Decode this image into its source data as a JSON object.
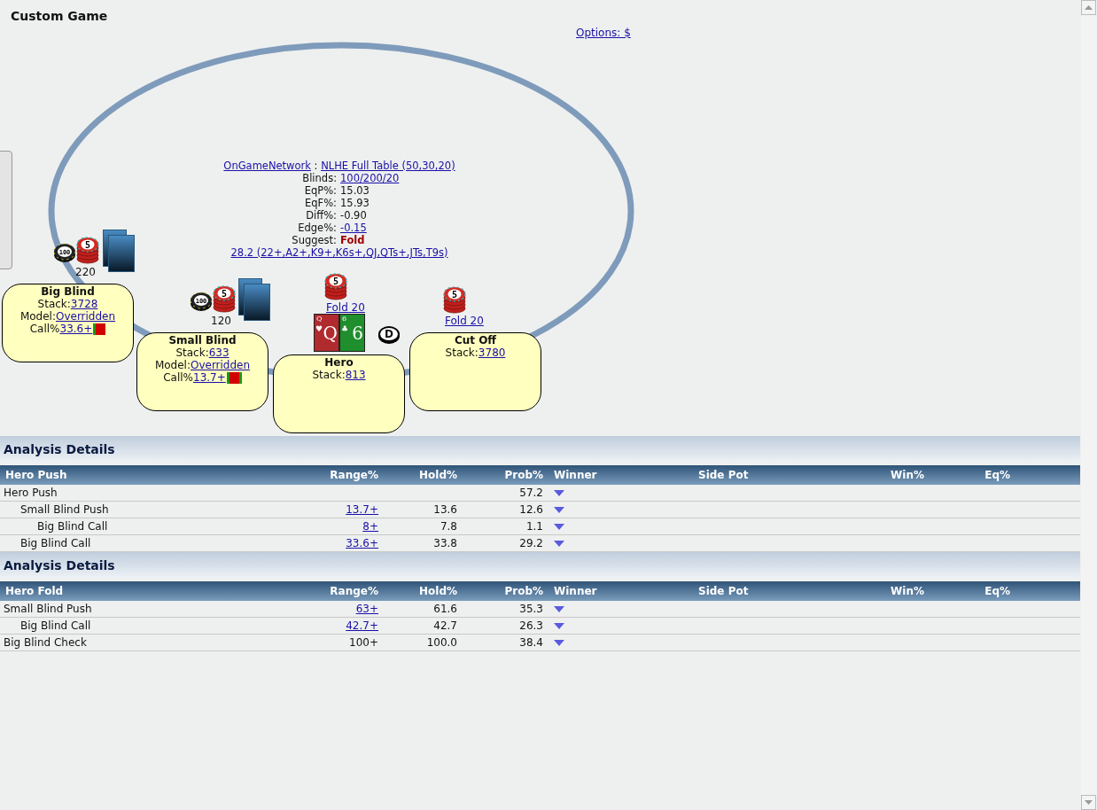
{
  "title": "Custom Game",
  "options_link": "Options: $",
  "table_info": {
    "site": "OnGameNetwork",
    "separator": ":",
    "structure": "NLHE Full Table (50,30,20)",
    "lines": [
      {
        "label": "Blinds:",
        "value": "100/200/20",
        "kind": "link"
      },
      {
        "label": "EqP%:",
        "value": "15.03",
        "kind": "plain"
      },
      {
        "label": "EqF%:",
        "value": "15.93",
        "kind": "plain"
      },
      {
        "label": "Diff%:",
        "value": "-0.90",
        "kind": "plain"
      },
      {
        "label": "Edge%:",
        "value": "-0.15",
        "kind": "link"
      },
      {
        "label": "Suggest:",
        "value": "Fold",
        "kind": "strong"
      }
    ],
    "range": "28.2 (22+,A2+,K9+,K6s+,QJ,QTs+,JTs,T9s)"
  },
  "seats": [
    {
      "name": "Big Blind",
      "fields": [
        {
          "label": "Stack:",
          "value": "3728"
        },
        {
          "label": "Model:",
          "value": "Overridden"
        },
        {
          "label": "Call%",
          "value": "33.6+",
          "bar": [
            {
              "kind": "edge",
              "color": "#1a9a1a"
            },
            {
              "kind": "fill",
              "color": "#d00000"
            }
          ]
        }
      ],
      "chips": [
        "100",
        "5"
      ],
      "bet": "220",
      "bet_link": false,
      "card_backs": true,
      "dealer": false
    },
    {
      "name": "Small Blind",
      "fields": [
        {
          "label": "Stack:",
          "value": "633"
        },
        {
          "label": "Model:",
          "value": "Overridden"
        },
        {
          "label": "Call%",
          "value": "13.7+",
          "bar": [
            {
              "kind": "edge",
              "color": "#1a9a1a"
            },
            {
              "kind": "fill",
              "color": "#d00000"
            },
            {
              "kind": "edge",
              "color": "#1a9a1a"
            }
          ]
        }
      ],
      "chips": [
        "100",
        "5"
      ],
      "bet": "120",
      "bet_link": false,
      "card_backs": true,
      "dealer": false
    },
    {
      "name": "Hero",
      "fields": [
        {
          "label": "Stack:",
          "value": "813"
        }
      ],
      "chips": [
        "5"
      ],
      "bet": "Fold 20",
      "bet_link": true,
      "card_backs": false,
      "hand": [
        {
          "corner": "Q",
          "rank": "Q",
          "suit": "♥",
          "color": "#b02a2e"
        },
        {
          "corner": "6",
          "rank": "6",
          "suit": "♣",
          "color": "#1f8e2c"
        }
      ],
      "dealer": true,
      "dealer_label": "D"
    },
    {
      "name": "Cut Off",
      "fields": [
        {
          "label": "Stack:",
          "value": "3780"
        }
      ],
      "chips": [
        "5"
      ],
      "bet": "Fold 20",
      "bet_link": true,
      "card_backs": false,
      "dealer": false
    }
  ],
  "sections": [
    {
      "heading": "Analysis Details",
      "columns": [
        "Hero Push",
        "Range%",
        "Hold%",
        "Prob%",
        "Winner",
        "Side Pot",
        "Win%",
        "Eq%"
      ],
      "rows": [
        {
          "name": "Hero Push",
          "prob": "57.2",
          "children": [
            {
              "name": "Small Blind Push",
              "range": "13.7+",
              "range_link": true,
              "hold": "13.6",
              "prob": "12.6",
              "children": [
                {
                  "name": "Big Blind Call",
                  "range": "8+",
                  "range_link": true,
                  "hold": "7.8",
                  "prob": "1.1"
                }
              ]
            },
            {
              "name": "Big Blind Call",
              "range": "33.6+",
              "range_link": true,
              "hold": "33.8",
              "prob": "29.2"
            }
          ]
        }
      ]
    },
    {
      "heading": "Analysis Details",
      "columns": [
        "Hero Fold",
        "Range%",
        "Hold%",
        "Prob%",
        "Winner",
        "Side Pot",
        "Win%",
        "Eq%"
      ],
      "rows": [
        {
          "name": "Small Blind Push",
          "range": "63+",
          "range_link": true,
          "hold": "61.6",
          "prob": "35.3",
          "children": [
            {
              "name": "Big Blind Call",
              "range": "42.7+",
              "range_link": true,
              "hold": "42.7",
              "prob": "26.3"
            }
          ]
        },
        {
          "name": "Big Blind Check",
          "range": "100+",
          "range_link": false,
          "hold": "100.0",
          "prob": "38.4"
        }
      ]
    }
  ]
}
